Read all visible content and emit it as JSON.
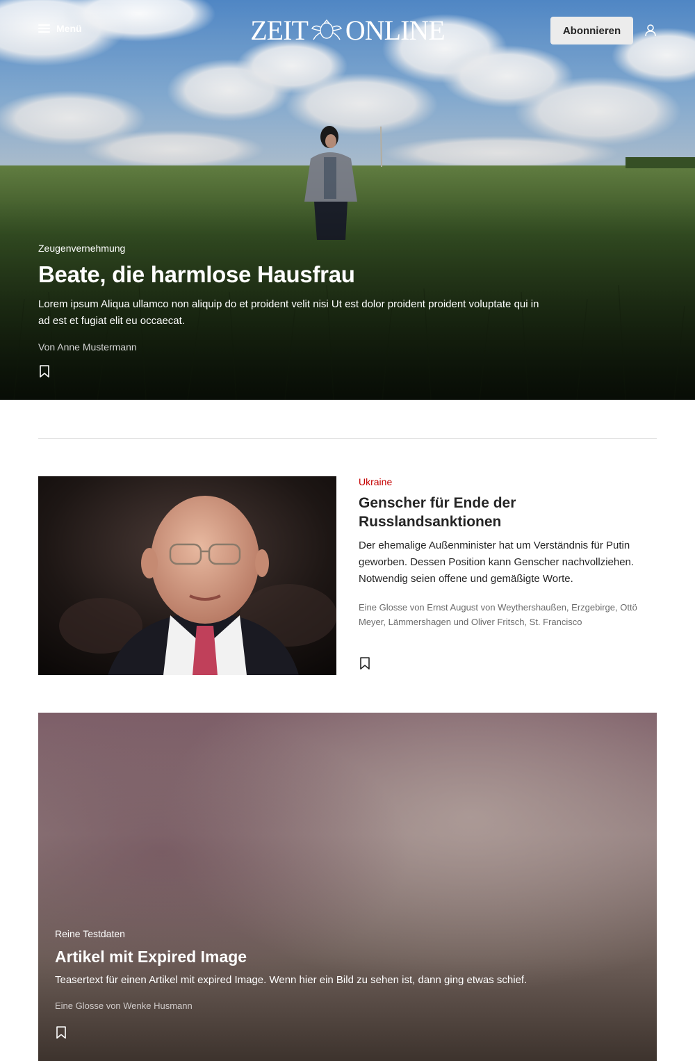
{
  "header": {
    "menu_label": "Menü",
    "logo_left": "ZEIT",
    "logo_right": "ONLINE",
    "subscribe_label": "Abonnieren"
  },
  "hero": {
    "kicker": "Zeugenvernehmung",
    "title": "Beate, die harmlose Hausfrau",
    "teaser": "Lorem ipsum Aliqua ullamco non aliquip do et proident velit nisi Ut est dolor proident proident voluptate qui in ad est et fugiat elit eu occaecat.",
    "byline": "Von Anne Mustermann"
  },
  "article2": {
    "kicker": "Ukraine",
    "title": "Genscher für Ende der Russlandsanktionen",
    "teaser": "Der ehemalige Außenminister hat um Verständnis für Putin geworben. Dessen Position kann Genscher nachvollziehen. Notwendig seien offene und gemäßigte Worte.",
    "byline": "Eine Glosse von Ernst August von Weythershaußen, Erzgebirge, Ottö Meyer, Lämmershagen und Oliver Fritsch, St. Francisco"
  },
  "article3": {
    "kicker": "Reine Testdaten",
    "title": "Artikel mit Expired Image",
    "teaser": "Teasertext für einen Artikel mit expired Image. Wenn hier ein Bild zu sehen ist, dann ging etwas schief.",
    "byline": "Eine Glosse von Wenke Husmann"
  },
  "colors": {
    "kicker_red": "#c50000",
    "text": "#252525",
    "byline_grey": "#6b6b6b",
    "subscribe_bg": "#ececec"
  },
  "icons": [
    "menu-icon",
    "user-icon",
    "bookmark-icon",
    "crest-icon"
  ]
}
